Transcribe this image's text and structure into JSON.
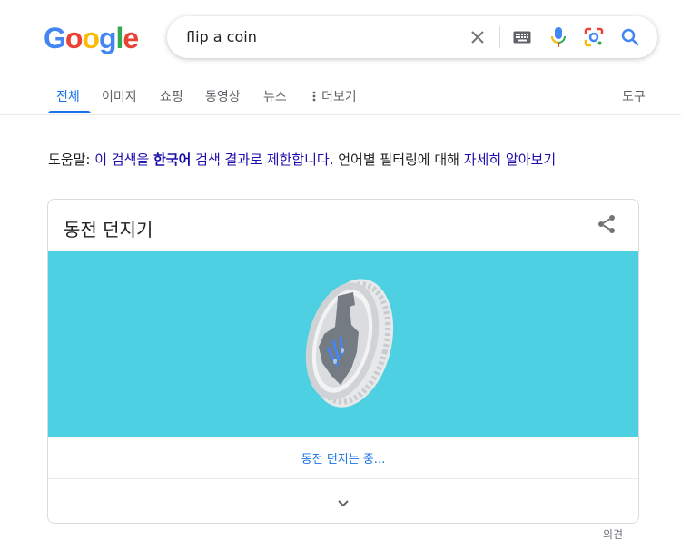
{
  "logo": {
    "letters": [
      {
        "char": "G",
        "color": "#4285f4"
      },
      {
        "char": "o",
        "color": "#ea4335"
      },
      {
        "char": "o",
        "color": "#fbbc05"
      },
      {
        "char": "g",
        "color": "#4285f4"
      },
      {
        "char": "l",
        "color": "#34a853"
      },
      {
        "char": "e",
        "color": "#ea4335"
      }
    ]
  },
  "search": {
    "query": "flip a coin"
  },
  "tabs": {
    "all": "전체",
    "images": "이미지",
    "shopping": "쇼핑",
    "videos": "동영상",
    "news": "뉴스",
    "more": "더보기",
    "tools": "도구"
  },
  "helper": {
    "prefix": "도움말: ",
    "part1": "이 검색을 ",
    "lang": "한국어",
    "part2": " 검색 결과로 제한합니다.",
    "part3": " 언어별 필터링에 대해 ",
    "learn": "자세히 알아보기"
  },
  "card": {
    "title": "동전 던지기",
    "status": "동전 던지는 중...",
    "bg_color": "#4dd0e1"
  },
  "feedback": "의견",
  "colors": {
    "accent": "#1a73e8",
    "link": "#1a0dab"
  }
}
